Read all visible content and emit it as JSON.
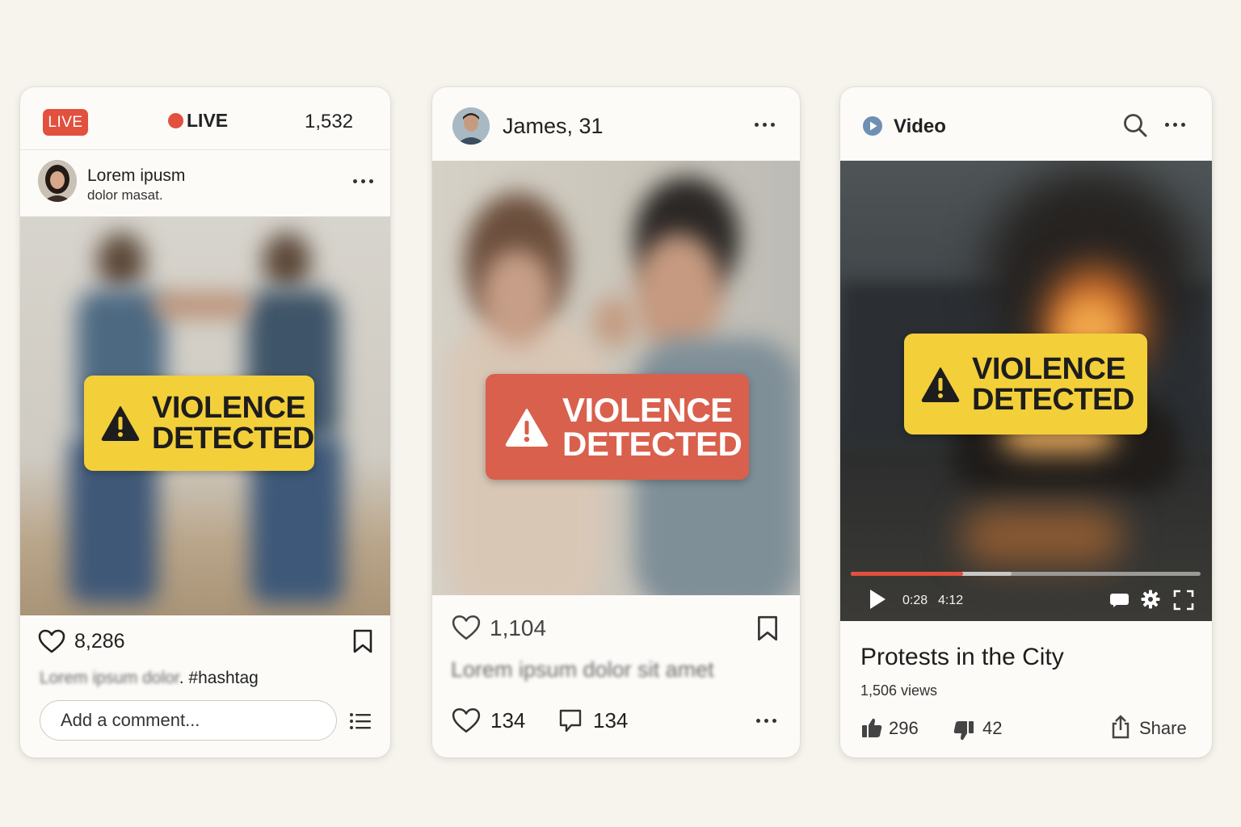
{
  "card1": {
    "live_badge": "LIVE",
    "live_indicator": "LIVE",
    "viewer_count": "1,532",
    "user_name": "Lorem ipusm",
    "user_subtitle": "dolor masat.",
    "warning_line1": "VIOLENCE",
    "warning_line2": "DETECTED",
    "likes": "8,286",
    "caption_blurred": "Lorem ipsum dolor",
    "caption_tail": ". #hashtag",
    "comment_placeholder": "Add a comment..."
  },
  "card2": {
    "user_name": "James, 31",
    "warning_line1": "VIOLENCE",
    "warning_line2": "DETECTED",
    "likes": "1,104",
    "caption_blurred": "Lorem ipsum dolor sit amet",
    "reactions": "134",
    "comments": "134"
  },
  "card3": {
    "header_title": "Video",
    "warning_line1": "VIOLENCE",
    "warning_line2": "DETECTED",
    "current_time": "0:28",
    "duration": "4:12",
    "played_fraction": 0.32,
    "buffered_fraction": 0.46,
    "title": "Protests in the City",
    "views": "1,506 views",
    "likes": "296",
    "dislikes": "42",
    "share_label": "Share"
  },
  "colors": {
    "live_red": "#e2503e",
    "warning_yellow": "#f3cf3a",
    "warning_red": "#d9604c"
  },
  "icons": [
    "heart-icon",
    "bookmark-icon",
    "comment-icon",
    "more-dots-icon",
    "search-icon",
    "play-icon",
    "captions-icon",
    "settings-icon",
    "fullscreen-icon",
    "thumbs-up-icon",
    "thumbs-down-icon",
    "share-icon",
    "list-icon",
    "warning-triangle-icon"
  ]
}
